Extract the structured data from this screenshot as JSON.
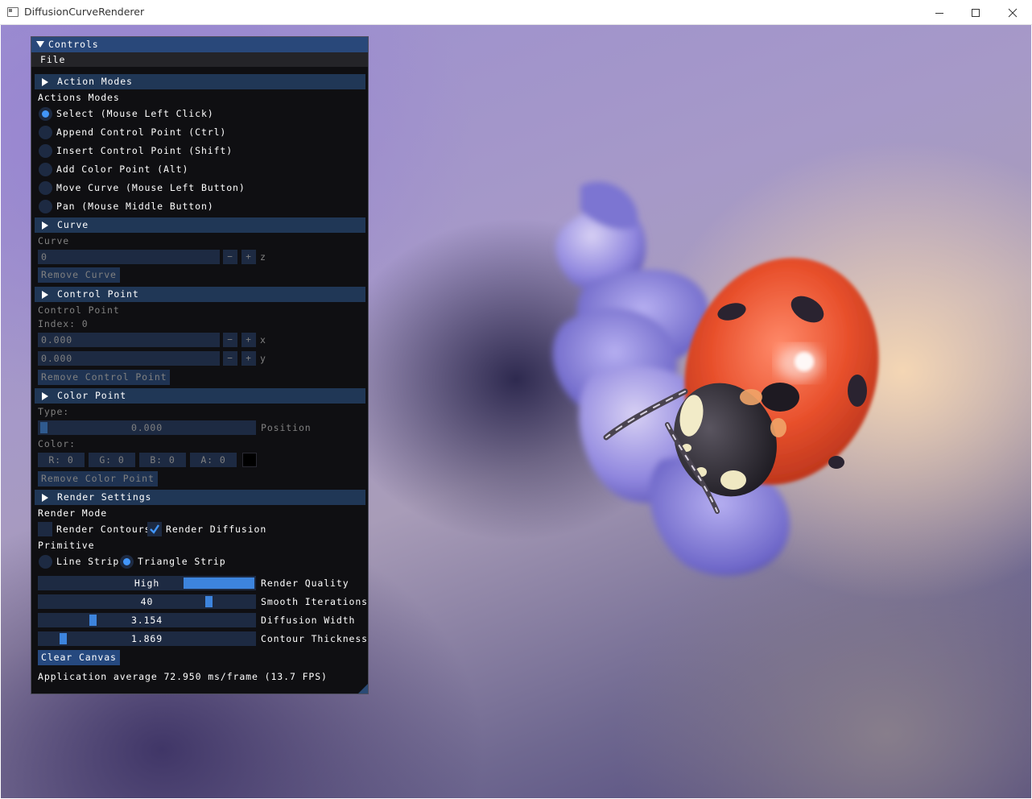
{
  "window": {
    "title": "DiffusionCurveRenderer"
  },
  "panel": {
    "title": "Controls",
    "menu": [
      "File"
    ],
    "action_modes": {
      "header": "Action Modes",
      "label": "Actions Modes",
      "options": [
        {
          "label": "Select (Mouse Left Click)",
          "selected": true
        },
        {
          "label": "Append Control Point (Ctrl)",
          "selected": false
        },
        {
          "label": "Insert Control Point (Shift)",
          "selected": false
        },
        {
          "label": "Add Color Point (Alt)",
          "selected": false
        },
        {
          "label": "Move Curve (Mouse Left Button)",
          "selected": false
        },
        {
          "label": "Pan (Mouse Middle Button)",
          "selected": false
        }
      ]
    },
    "curve": {
      "header": "Curve",
      "label": "Curve",
      "z_value": "0",
      "z_label": "z",
      "minus": "−",
      "plus": "+",
      "remove_button": "Remove Curve"
    },
    "control_point": {
      "header": "Control Point",
      "label": "Control Point",
      "index_label": "Index: 0",
      "x_value": "0.000",
      "x_label": "x",
      "y_value": "0.000",
      "y_label": "y",
      "minus": "−",
      "plus": "+",
      "remove_button": "Remove Control Point"
    },
    "color_point": {
      "header": "Color Point",
      "type_label": "Type:",
      "position_value": "0.000",
      "position_label": "Position",
      "color_label": "Color:",
      "r": "R:  0",
      "g": "G:  0",
      "b": "B:  0",
      "a": "A:  0",
      "swatch_color": "#000000",
      "remove_button": "Remove Color Point"
    },
    "render_settings": {
      "header": "Render Settings",
      "render_mode_label": "Render Mode",
      "render_contours": {
        "label": "Render Contours",
        "checked": false
      },
      "render_diffusion": {
        "label": "Render Diffusion",
        "checked": true
      },
      "primitive_label": "Primitive",
      "line_strip": {
        "label": "Line Strip",
        "selected": false
      },
      "triangle_strip": {
        "label": "Triangle Strip",
        "selected": true
      },
      "render_quality": {
        "value": "High",
        "label": "Render Quality",
        "level": 1.0
      },
      "smooth_iterations": {
        "value": "40",
        "label": "Smooth Iterations"
      },
      "diffusion_width": {
        "value": "3.154",
        "label": "Diffusion Width"
      },
      "contour_thickness": {
        "value": "1.869",
        "label": "Contour Thickness"
      },
      "clear_button": "Clear Canvas"
    },
    "status": "Application average 72.950 ms/frame (13.7 FPS)"
  },
  "colors": {
    "accent": "#4296fa",
    "header": "#203756",
    "title_bar": "#29487a",
    "panel_bg": "#0f0f12",
    "ladybug_red": "#e0472a"
  }
}
